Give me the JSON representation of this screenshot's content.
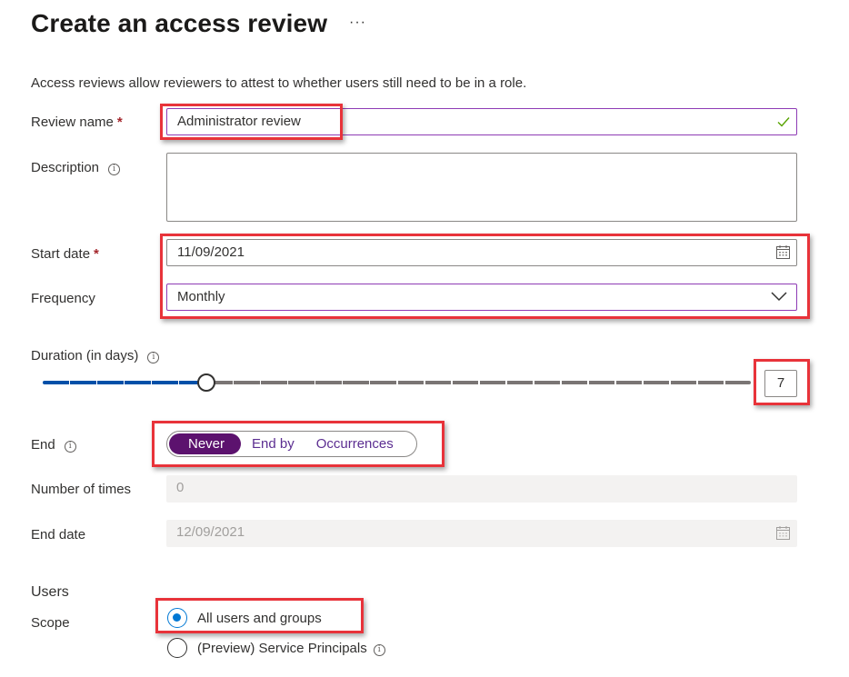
{
  "header": {
    "title": "Create an access review",
    "more_label": "···"
  },
  "intro": "Access reviews allow reviewers to attest to whether users still need to be in a role.",
  "form": {
    "review_name": {
      "label": "Review name",
      "required_mark": "*",
      "value": "Administrator review",
      "status_icon": "checkmark-icon"
    },
    "description": {
      "label": "Description",
      "info_icon": "i",
      "value": ""
    },
    "start_date": {
      "label": "Start date",
      "required_mark": "*",
      "value": "11/09/2021",
      "icon": "calendar-icon"
    },
    "frequency": {
      "label": "Frequency",
      "value": "Monthly",
      "icon": "chevron-down-icon"
    },
    "duration": {
      "label": "Duration (in days)",
      "info_icon": "i",
      "value": 7,
      "value_text": "7",
      "min": 1,
      "max": 27,
      "fill_fraction": 0.231
    },
    "end": {
      "label": "End",
      "info_icon": "i",
      "options": [
        "Never",
        "End by",
        "Occurrences"
      ],
      "selected": "Never"
    },
    "number_of_times": {
      "label": "Number of times",
      "value": "0",
      "disabled": true
    },
    "end_date": {
      "label": "End date",
      "value": "12/09/2021",
      "disabled": true,
      "icon": "calendar-icon"
    }
  },
  "users": {
    "section_title": "Users",
    "scope_label": "Scope",
    "scope_options": [
      {
        "label": "All users and groups",
        "checked": true
      },
      {
        "label": "(Preview) Service Principals",
        "checked": false,
        "info_icon": "i"
      }
    ]
  },
  "colors": {
    "accent_purple": "#5c126e",
    "focus_border": "#8e3bb5",
    "slider_fill": "#0050a8",
    "slider_track": "#7a7574",
    "radio_checked": "#0078d4",
    "highlight_box": "#e8333a",
    "valid_check": "#57a300"
  }
}
